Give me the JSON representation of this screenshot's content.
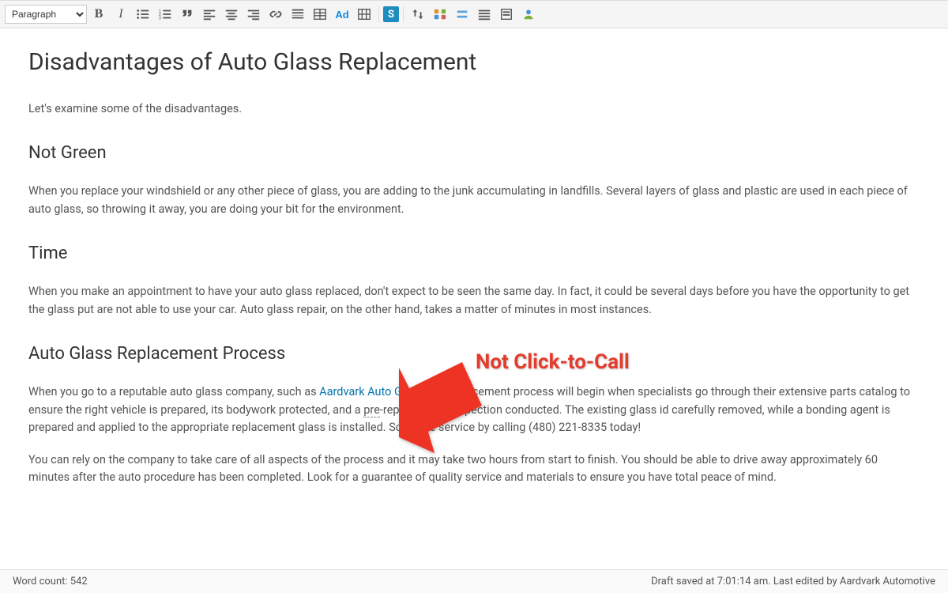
{
  "toolbar": {
    "format_selected": "Paragraph",
    "ad_label": "Ad",
    "s_label": "S"
  },
  "article": {
    "h1": "Disadvantages of Auto Glass Replacement",
    "p1": "Let's examine some of the disadvantages.",
    "h2_a": "Not Green",
    "p2": "When you replace your windshield or any other piece of glass, you are adding to the junk accumulating in landfills. Several layers of glass and plastic are used in each piece of auto glass, so throwing it away, you are doing your bit for the environment.",
    "h2_b": "Time",
    "p3": "When you make an appointment to have your auto glass replaced, don't expect to be seen the same day. In fact, it could be several days before you have the opportunity to get the glass put are not able to use your car. Auto glass repair, on the other hand, takes a matter of minutes in most instances.",
    "h2_c": "Auto Glass Replacement Process",
    "p4_a": "When you go to a reputable auto glass company, such as ",
    "p4_link": "Aardvark Auto Glass",
    "p4_b": "placement process will begin when specialists go through their extensive parts catalog to ensure the right vehicle is prepared, its bodywork protected, and a ",
    "p4_pre": "pre",
    "p4_c": "-replacement inspection conducted. The existing glass id carefully removed, while a bonding agent is prepared and applied to the appropriate replacement glass is installed. Schedule service by calling (480) 221-8335 today!",
    "p5": "You can rely on the company to take care of all aspects of the process and it may take two hours from start to finish. You should be able to drive away approximately 60 minutes after the auto procedure has been completed. Look for a guarantee of quality service and materials to ensure you have total peace of mind."
  },
  "annotation": {
    "label": "Not Click-to-Call"
  },
  "status": {
    "wordcount_label": "Word count: ",
    "wordcount_value": "542",
    "saved": "Draft saved at 7:01:14 am. Last edited by Aardvark Automotive"
  }
}
